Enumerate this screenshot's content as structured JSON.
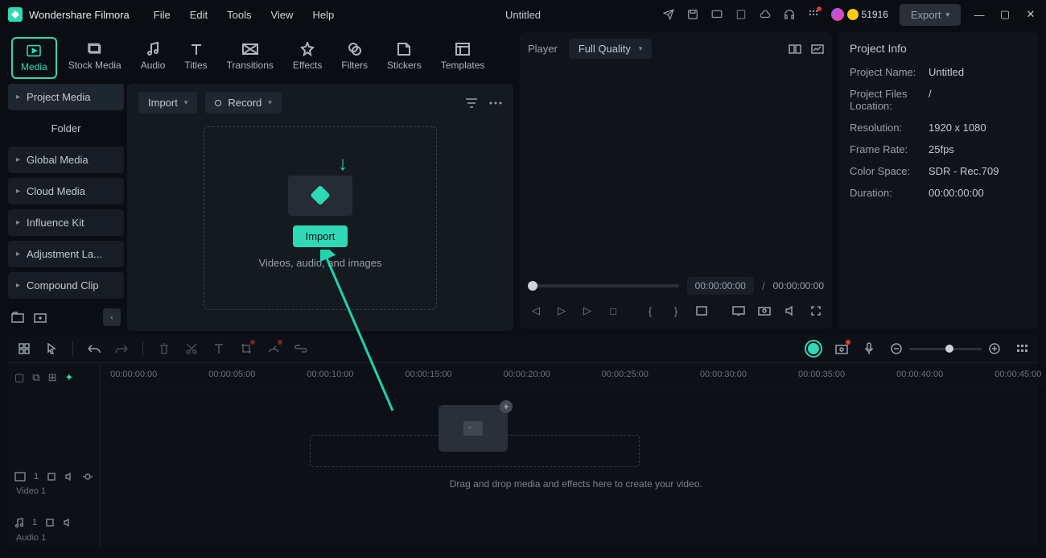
{
  "app": {
    "name": "Wondershare Filmora",
    "title": "Untitled",
    "coins": "51916",
    "export": "Export"
  },
  "menu": [
    "File",
    "Edit",
    "Tools",
    "View",
    "Help"
  ],
  "tabs": [
    "Media",
    "Stock Media",
    "Audio",
    "Titles",
    "Transitions",
    "Effects",
    "Filters",
    "Stickers",
    "Templates"
  ],
  "sidebar": {
    "head": "Project Media",
    "folder": "Folder",
    "items": [
      "Global Media",
      "Cloud Media",
      "Influence Kit",
      "Adjustment La...",
      "Compound Clip"
    ]
  },
  "media": {
    "import": "Import",
    "record": "Record",
    "importBtn": "Import",
    "dzText": "Videos, audio, and images"
  },
  "player": {
    "label": "Player",
    "quality": "Full Quality",
    "time1": "00:00:00:00",
    "sep": "/",
    "time2": "00:00:00:00"
  },
  "info": {
    "title": "Project Info",
    "rows": [
      {
        "l": "Project Name:",
        "v": "Untitled"
      },
      {
        "l": "Project Files Location:",
        "v": "/"
      },
      {
        "l": "Resolution:",
        "v": "1920 x 1080"
      },
      {
        "l": "Frame Rate:",
        "v": "25fps"
      },
      {
        "l": "Color Space:",
        "v": "SDR - Rec.709"
      },
      {
        "l": "Duration:",
        "v": "00:00:00:00"
      }
    ]
  },
  "ruler": [
    "00:00:00:00",
    "00:00:05:00",
    "00:00:10:00",
    "00:00:15:00",
    "00:00:20:00",
    "00:00:25:00",
    "00:00:30:00",
    "00:00:35:00",
    "00:00:40:00",
    "00:00:45:00"
  ],
  "tracks": {
    "video": "Video 1",
    "audio": "Audio 1"
  },
  "dropText": "Drag and drop media and effects here to create your video."
}
